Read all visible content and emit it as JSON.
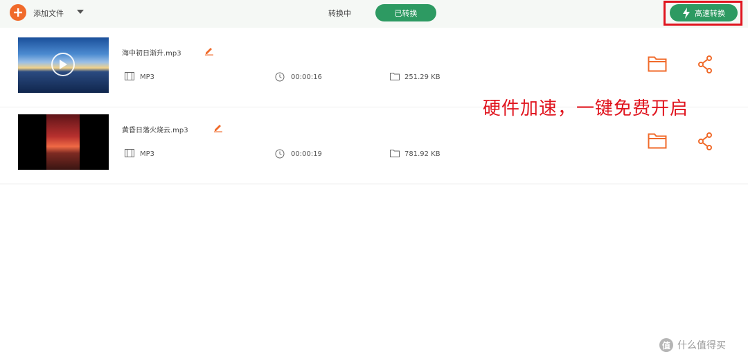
{
  "toolbar": {
    "add_files_label": "添加文件",
    "tab_converting": "转换中",
    "tab_converted": "已转换",
    "fast_convert_label": "高速转换"
  },
  "files": [
    {
      "name": "海中初日渐升.mp3",
      "format": "MP3",
      "duration": "00:00:16",
      "size": "251.29 KB"
    },
    {
      "name": "黄昏日落火烧云.mp3",
      "format": "MP3",
      "duration": "00:00:19",
      "size": "781.92 KB"
    }
  ],
  "annotation": {
    "promo_text": "硬件加速，一键免费开启"
  },
  "watermark": {
    "logo_text": "值",
    "text": "什么值得买"
  },
  "colors": {
    "accent_orange": "#f06a2a",
    "green": "#2d9a62",
    "highlight_red": "#e0141e"
  }
}
